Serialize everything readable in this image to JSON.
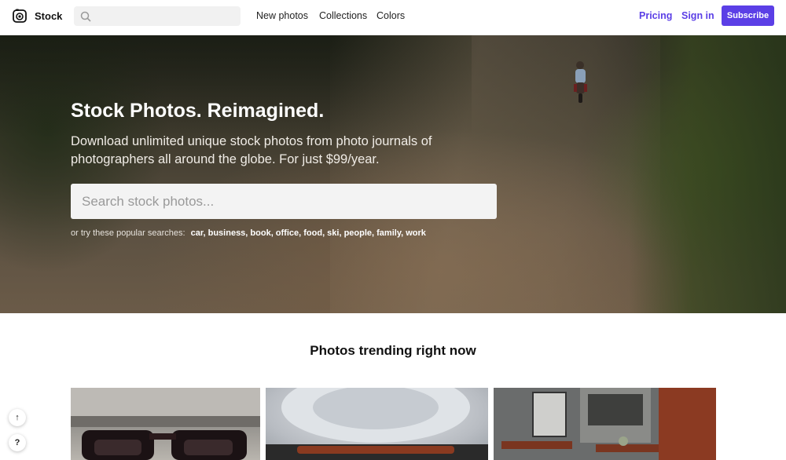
{
  "header": {
    "logo_text": "Stock",
    "nav": [
      "New photos",
      "Collections",
      "Colors"
    ],
    "pricing": "Pricing",
    "signin": "Sign in",
    "subscribe": "Subscribe"
  },
  "hero": {
    "title": "Stock Photos. Reimagined.",
    "subtitle": "Download unlimited unique stock photos from photo journals of photographers all around the globe. For just $99/year.",
    "search_placeholder": "Search stock photos...",
    "popular_label": "or try these popular searches:",
    "popular_terms": "car, business, book, office, food, ski, people, family, work"
  },
  "trending": {
    "title": "Photos trending right now"
  },
  "side_buttons": {
    "up": "↑",
    "help": "?"
  },
  "colors": {
    "accent": "#5b3fe6"
  }
}
